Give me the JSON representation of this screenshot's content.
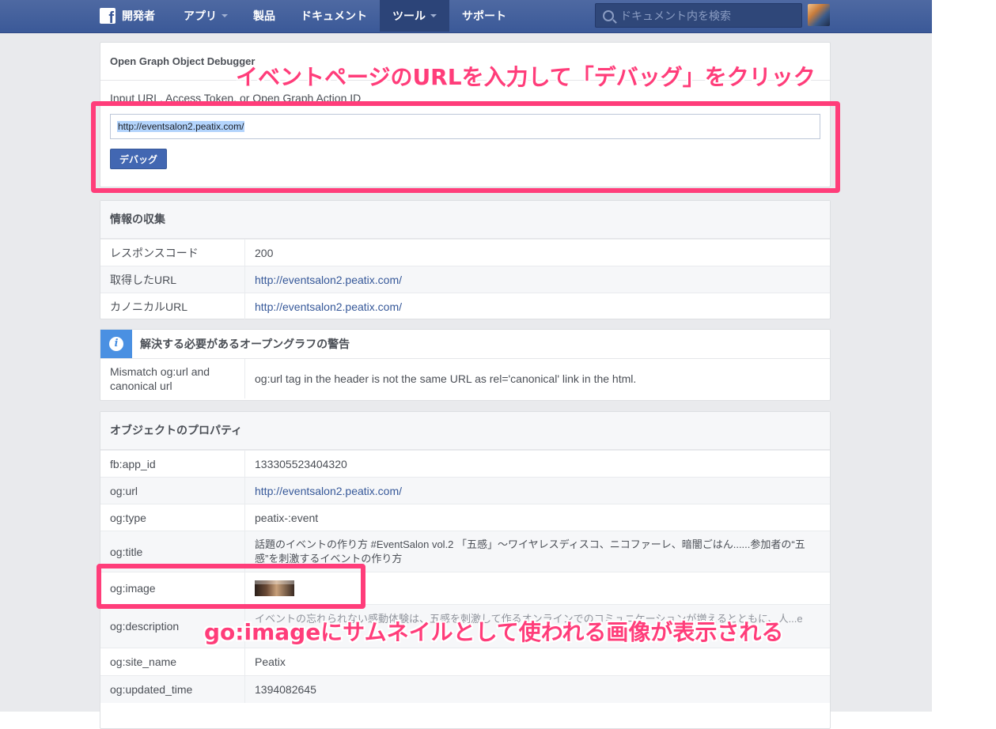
{
  "topbar": {
    "brand": "開発者",
    "nav": [
      {
        "label": "アプリ",
        "dropdown": true
      },
      {
        "label": "製品",
        "dropdown": false
      },
      {
        "label": "ドキュメント",
        "dropdown": false
      },
      {
        "label": "ツール",
        "dropdown": true,
        "active": true
      },
      {
        "label": "サポート",
        "dropdown": false
      }
    ],
    "search_placeholder": "ドキュメント内を検索"
  },
  "debugger": {
    "title": "Open Graph Object Debugger",
    "input_label": "Input URL, Access Token, or Open Graph Action ID",
    "input_value": "http://eventsalon2.peatix.com/",
    "button_label": "デバッグ"
  },
  "scrape": {
    "title": "情報の収集",
    "rows": [
      {
        "key": "レスポンスコード",
        "value": "200"
      },
      {
        "key": "取得したURL",
        "value": "http://eventsalon2.peatix.com/"
      },
      {
        "key": "カノニカルURL",
        "value": "http://eventsalon2.peatix.com/"
      }
    ]
  },
  "warnings": {
    "title": "解決する必要があるオープングラフの警告",
    "key": "Mismatch og:url and canonical url",
    "value": "og:url tag in the header is not the same URL as rel='canonical' link in the html."
  },
  "properties": {
    "title": "オブジェクトのプロパティ",
    "rows": [
      {
        "key": "fb:app_id",
        "value": "133305523404320"
      },
      {
        "key": "og:url",
        "value": "http://eventsalon2.peatix.com/"
      },
      {
        "key": "og:type",
        "value": "peatix-:event"
      },
      {
        "key": "og:title",
        "value": "話題のイベントの作り方 #EventSalon vol.2 「五感」〜ワイヤレスディスコ、ニコファーレ、暗闇ごはん......参加者の“五感”を刺激するイベントの作り方"
      },
      {
        "key": "og:image",
        "value": ""
      },
      {
        "key": "og:description",
        "value": "イベントの忘れられない感動体験は、五感を刺激して作るオンラインでのコミュニケーションが増えるとともに、人...e than a ticket."
      },
      {
        "key": "og:site_name",
        "value": "Peatix"
      },
      {
        "key": "og:updated_time",
        "value": "1394082645"
      }
    ]
  },
  "annotations": {
    "top": "イベントページのURLを入力して「デバッグ」をクリック",
    "bottom": "go:imageにサムネイルとして使われる画像が表示される"
  },
  "colors": {
    "topbar": "#3b5998",
    "link": "#365899",
    "annotation": "#ff3d7a",
    "info": "#4a90e2"
  }
}
